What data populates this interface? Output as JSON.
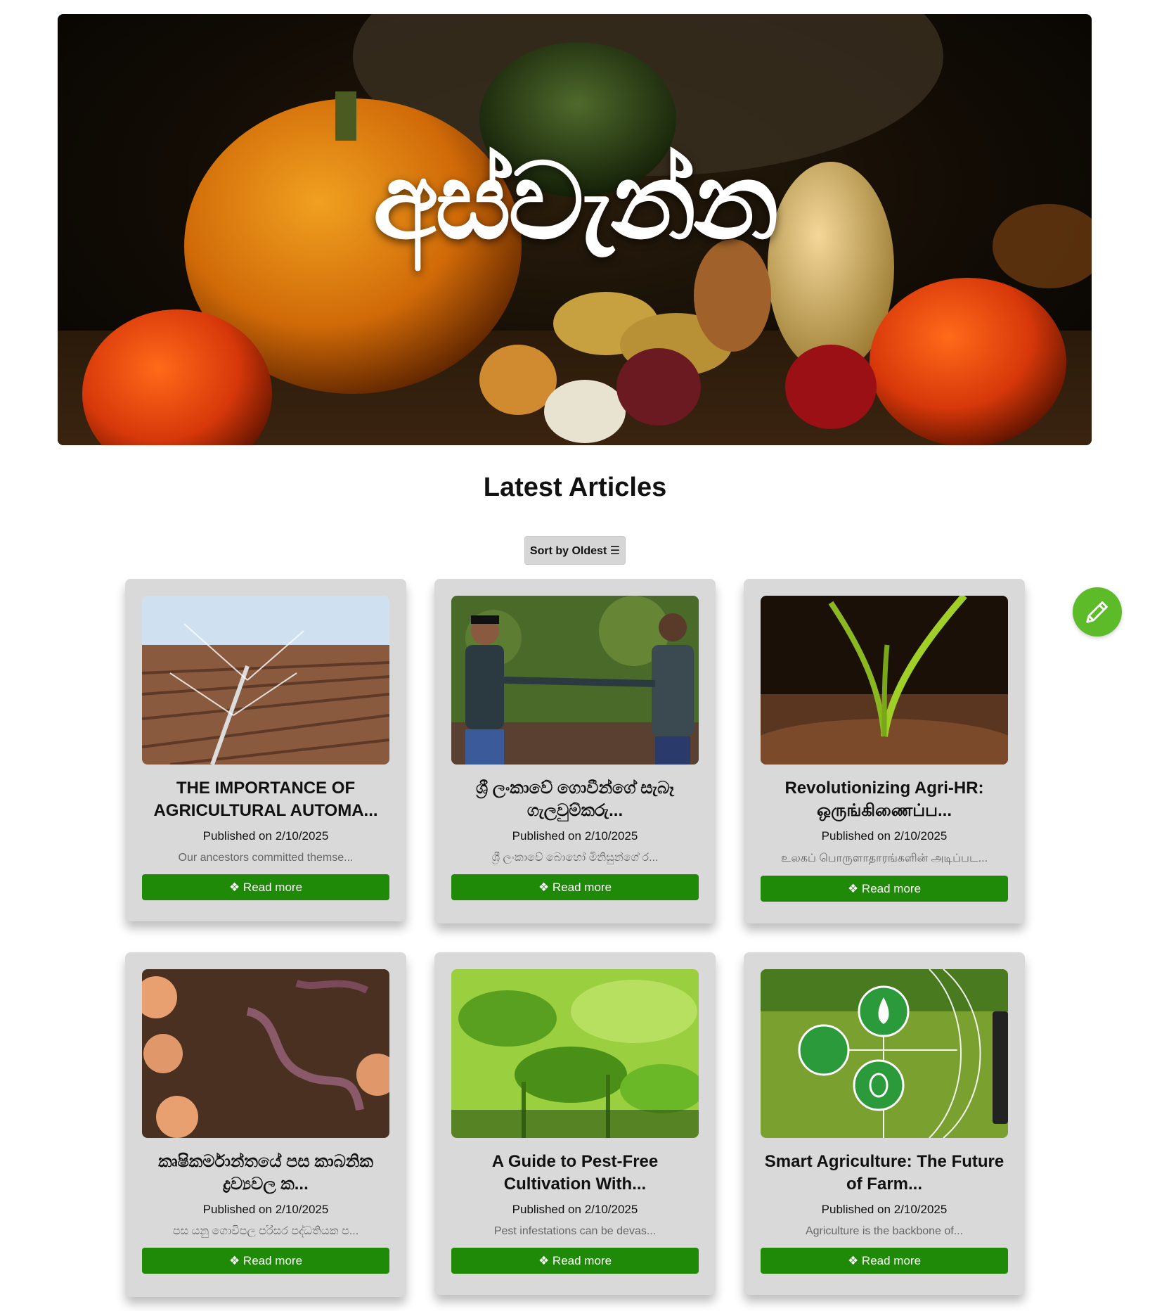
{
  "hero": {
    "title": "අස්වැන්න"
  },
  "section": {
    "title": "Latest Articles"
  },
  "sort": {
    "label": "Sort by Oldest ☰"
  },
  "fab": {
    "icon": "pencil-icon",
    "color": "#5dbb2a"
  },
  "colors": {
    "read_button": "#1f8a07",
    "card_bg": "#d9d9d9"
  },
  "articles": [
    {
      "image": "irrigation-field",
      "title": "THE IMPORTANCE OF AGRICULTURAL AUTOMA...",
      "date": "Published on 2/10/2025",
      "excerpt": "Our ancestors committed themse...",
      "button": "❖ Read more"
    },
    {
      "image": "two-farmers",
      "title": "ශ්‍රී ලංකාවේ ගොවීන්ගේ සැබෑ ගැලවුම්කරු...",
      "date": "Published on 2/10/2025",
      "excerpt": "ශ්‍රී ලංකාවේ බොහෝ මිනිසුන්ගේ ර...",
      "button": "❖ Read more"
    },
    {
      "image": "seedling-soil",
      "title": "Revolutionizing Agri-HR: ஒருங்கிணைப்ப...",
      "date": "Published on 2/10/2025",
      "excerpt": "உலகப் பொருளாதாரங்களின் அடிப்பட...",
      "button": "❖ Read more"
    },
    {
      "image": "soil-worms",
      "title": "කෘෂිකර්මාන්තයේ පස කාබනික ද්‍රව්‍යවල ක...",
      "date": "Published on 2/10/2025",
      "excerpt": "පස යනු ගොවිපල පරිසර පද්ධතියක ප...",
      "button": "❖ Read more"
    },
    {
      "image": "green-plants",
      "title": "A Guide to Pest-Free Cultivation With...",
      "date": "Published on 2/10/2025",
      "excerpt": "Pest infestations can be devas...",
      "button": "❖ Read more"
    },
    {
      "image": "smart-agriculture",
      "title": "Smart Agriculture: The Future of Farm...",
      "date": "Published on 2/10/2025",
      "excerpt": "Agriculture is the backbone of...",
      "button": "❖ Read more"
    }
  ]
}
